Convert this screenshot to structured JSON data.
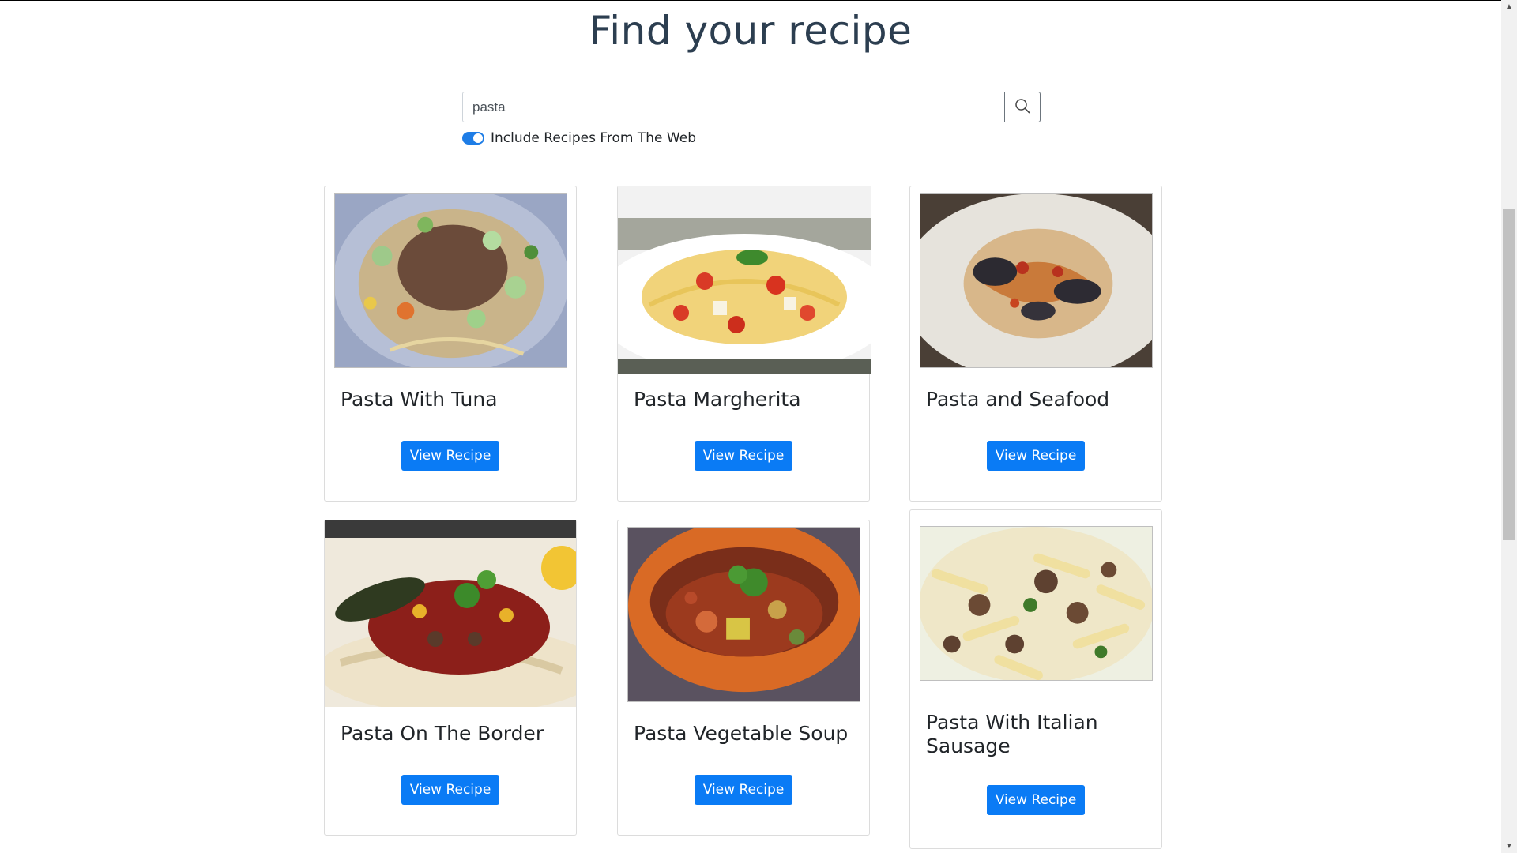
{
  "page": {
    "title": "Find your recipe"
  },
  "search": {
    "value": "pasta",
    "toggle_label": "Include Recipes From The Web",
    "toggle_on": true
  },
  "cards": [
    {
      "title": "Pasta With Tuna",
      "button": "View Recipe",
      "image": "pasta-with-tuna-photo"
    },
    {
      "title": "Pasta Margherita",
      "button": "View Recipe",
      "image": "pasta-margherita-photo"
    },
    {
      "title": "Pasta and Seafood",
      "button": "View Recipe",
      "image": "pasta-and-seafood-photo"
    },
    {
      "title": "Pasta On The Border",
      "button": "View Recipe",
      "image": "pasta-on-the-border-photo"
    },
    {
      "title": "Pasta Vegetable Soup",
      "button": "View Recipe",
      "image": "pasta-vegetable-soup-photo"
    },
    {
      "title": "Pasta With Italian Sausage",
      "button": "View Recipe",
      "image": "pasta-with-italian-sausage-photo"
    }
  ],
  "colors": {
    "accent": "#0a7bf5",
    "title": "#2c3e50",
    "toggle": "#1e7de6"
  },
  "icons": {
    "search": "search-icon",
    "scroll_up": "chevron-up-icon",
    "scroll_down": "chevron-down-icon"
  }
}
